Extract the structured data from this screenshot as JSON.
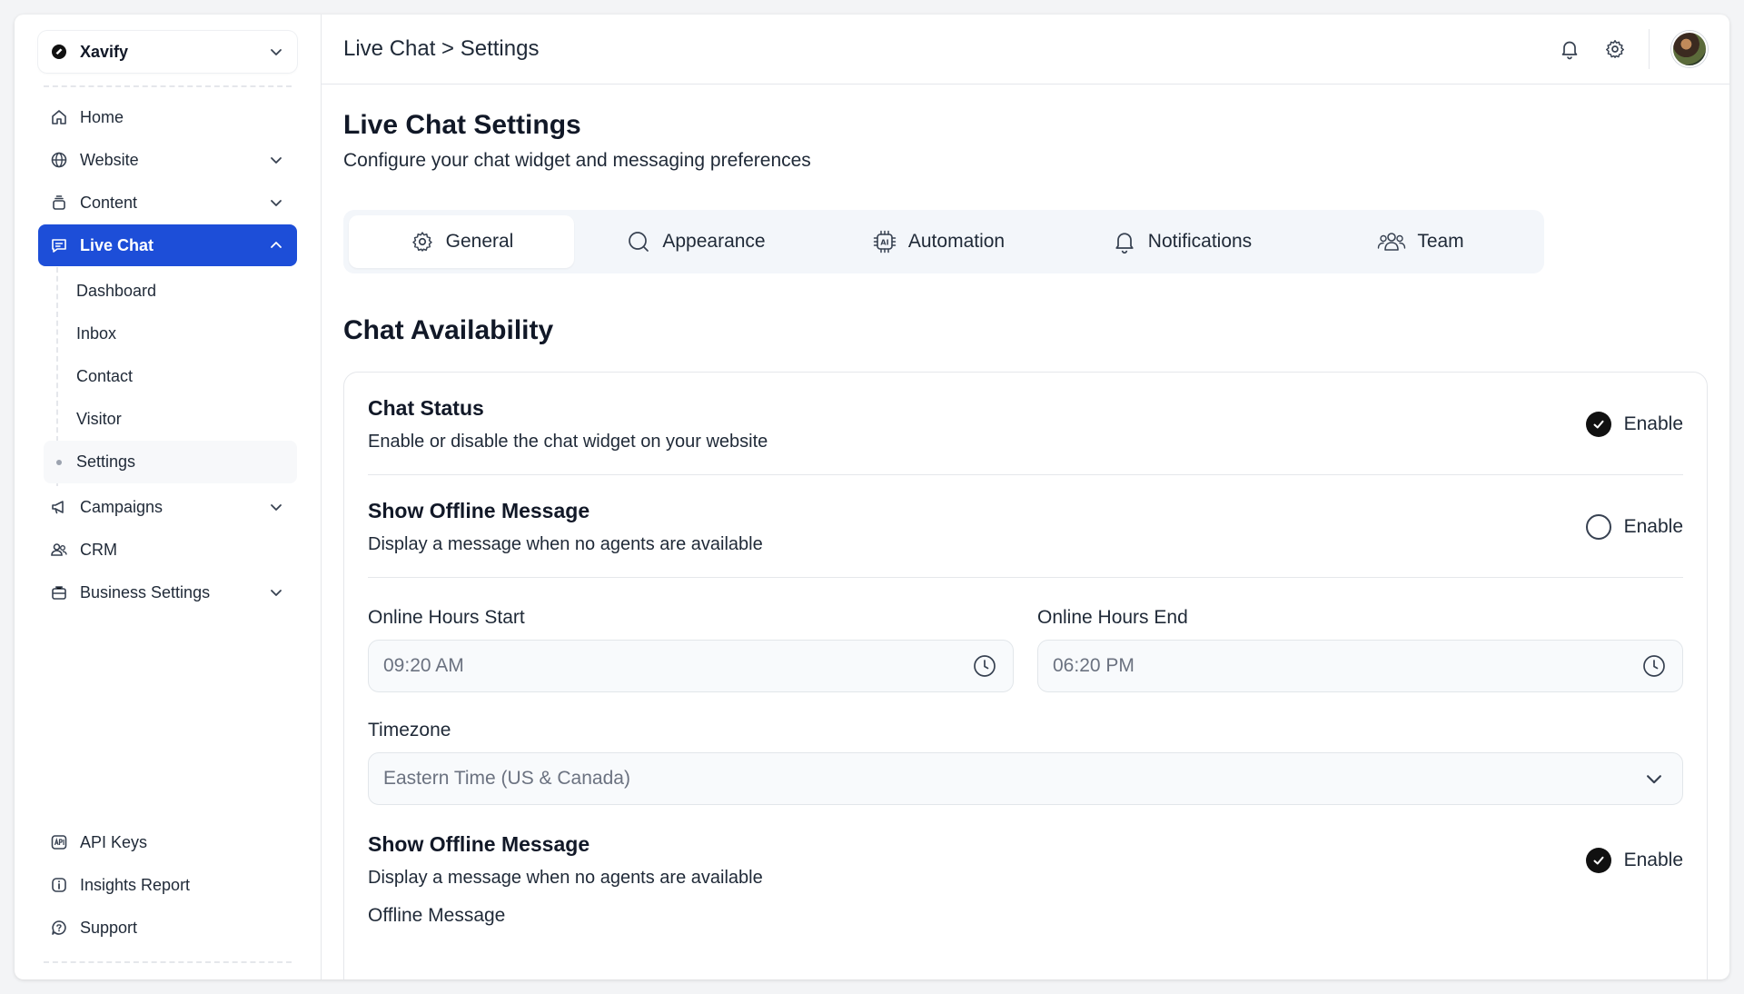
{
  "workspace": {
    "name": "Xavify"
  },
  "sidebar": {
    "items": [
      {
        "label": "Home"
      },
      {
        "label": "Website"
      },
      {
        "label": "Content"
      },
      {
        "label": "Live Chat"
      },
      {
        "label": "Campaigns"
      },
      {
        "label": "CRM"
      },
      {
        "label": "Business Settings"
      }
    ],
    "live_chat_sub": [
      {
        "label": "Dashboard"
      },
      {
        "label": "Inbox"
      },
      {
        "label": "Contact"
      },
      {
        "label": "Visitor"
      },
      {
        "label": "Settings"
      }
    ],
    "bottom": [
      {
        "label": "API Keys"
      },
      {
        "label": "Insights Report"
      },
      {
        "label": "Support"
      }
    ]
  },
  "header": {
    "breadcrumb": "Live Chat > Settings"
  },
  "page": {
    "title": "Live Chat Settings",
    "subtitle": "Configure your chat widget and messaging preferences"
  },
  "tabs": [
    {
      "label": "General",
      "icon": "gear-icon",
      "active": true
    },
    {
      "label": "Appearance",
      "icon": "search-icon"
    },
    {
      "label": "Automation",
      "icon": "ai-chip-icon"
    },
    {
      "label": "Notifications",
      "icon": "bell-icon"
    },
    {
      "label": "Team",
      "icon": "users-icon"
    }
  ],
  "section": {
    "title": "Chat Availability"
  },
  "settings": {
    "chat_status": {
      "title": "Chat Status",
      "desc": "Enable or disable the chat widget on your website",
      "toggle": "Enable",
      "checked": true
    },
    "offline_message": {
      "title": "Show Offline Message",
      "desc": "Display a message when no agents are available",
      "toggle": "Enable",
      "checked": false
    },
    "hours_start": {
      "label": "Online Hours Start",
      "value": "09:20 AM"
    },
    "hours_end": {
      "label": "Online Hours End",
      "value": "06:20 PM"
    },
    "timezone": {
      "label": "Timezone",
      "value": "Eastern Time (US & Canada)"
    },
    "offline_message_2": {
      "title": "Show Offline Message",
      "desc": "Display a message when no agents are available",
      "toggle": "Enable",
      "checked": true
    },
    "offline_message_label": "Offline Message"
  },
  "colors": {
    "accent": "#1d4ed8"
  }
}
